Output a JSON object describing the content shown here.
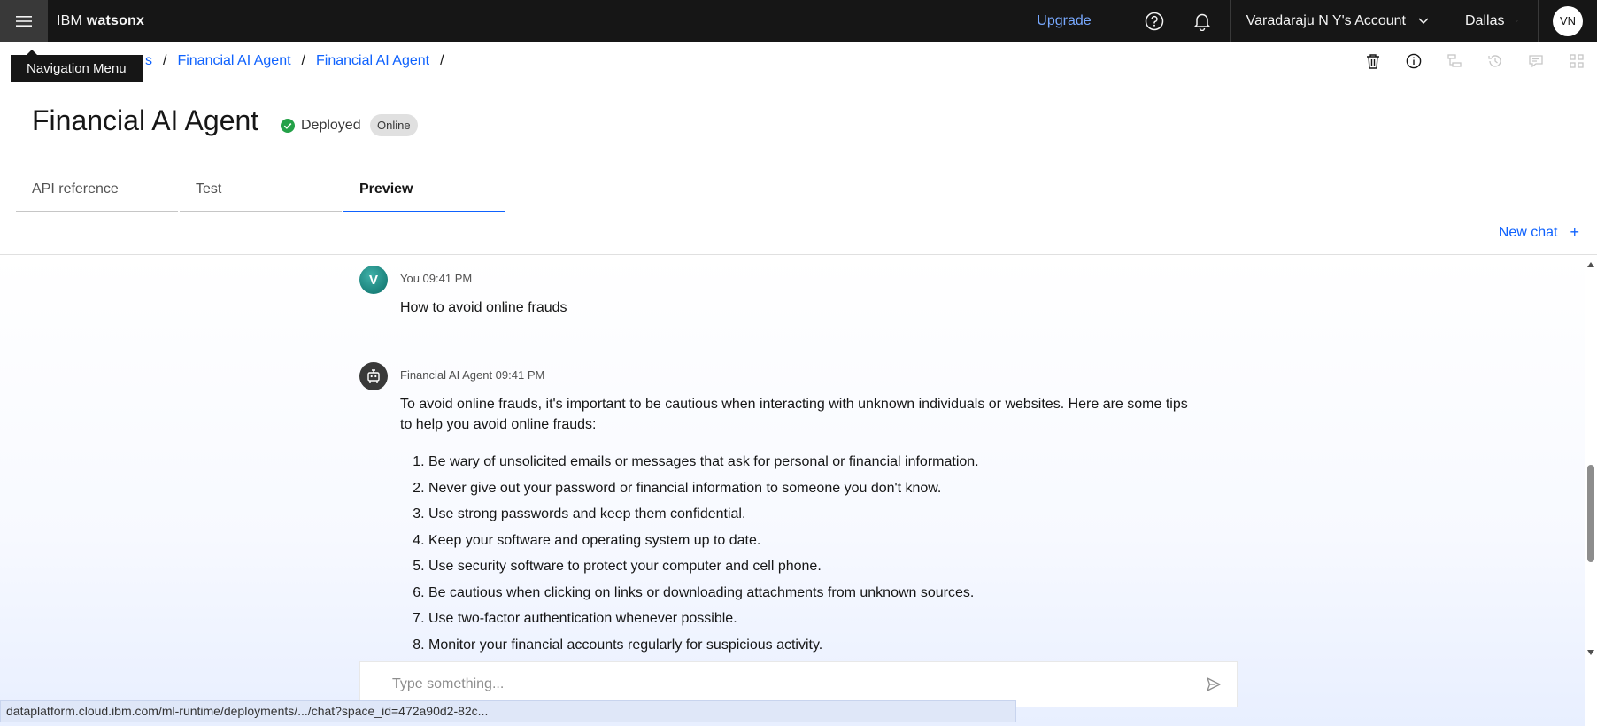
{
  "topbar": {
    "brand_prefix": "IBM",
    "brand_name": "watsonx",
    "upgrade": "Upgrade",
    "account": "Varadaraju N Y's Account",
    "region": "Dallas",
    "avatar_initials": "VN"
  },
  "tooltip": {
    "text": "Navigation Menu"
  },
  "breadcrumb": {
    "items": [
      "s",
      "Financial AI Agent",
      "Financial AI Agent"
    ],
    "separator": "/"
  },
  "header": {
    "title": "Financial AI Agent",
    "status": "Deployed",
    "tag": "Online"
  },
  "tabs": [
    {
      "label": "API reference",
      "active": false
    },
    {
      "label": "Test",
      "active": false
    },
    {
      "label": "Preview",
      "active": true
    }
  ],
  "new_chat": {
    "label": "New chat",
    "icon": "+"
  },
  "messages": [
    {
      "avatar": "V",
      "meta": "You 09:41 PM",
      "text": "How to avoid online frauds"
    },
    {
      "avatar_icon": "robot-icon",
      "meta": "Financial AI Agent 09:41 PM",
      "intro": "To avoid online frauds, it's important to be cautious when interacting with unknown individuals or websites. Here are some tips to help you avoid online frauds:",
      "list": [
        "Be wary of unsolicited emails or messages that ask for personal or financial information.",
        "Never give out your password or financial information to someone you don't know.",
        "Use strong passwords and keep them confidential.",
        "Keep your software and operating system up to date.",
        "Use security software to protect your computer and cell phone.",
        "Be cautious when clicking on links or downloading attachments from unknown sources.",
        "Use two-factor authentication whenever possible.",
        "Monitor your financial accounts regularly for suspicious activity."
      ]
    }
  ],
  "input": {
    "placeholder": "Type something...",
    "value": ""
  },
  "status_url": "dataplatform.cloud.ibm.com/ml-runtime/deployments/.../chat?space_id=472a90d2-82c...",
  "colors": {
    "accent": "#0f62fe",
    "topbar": "#161616",
    "deployed": "#24a148"
  }
}
